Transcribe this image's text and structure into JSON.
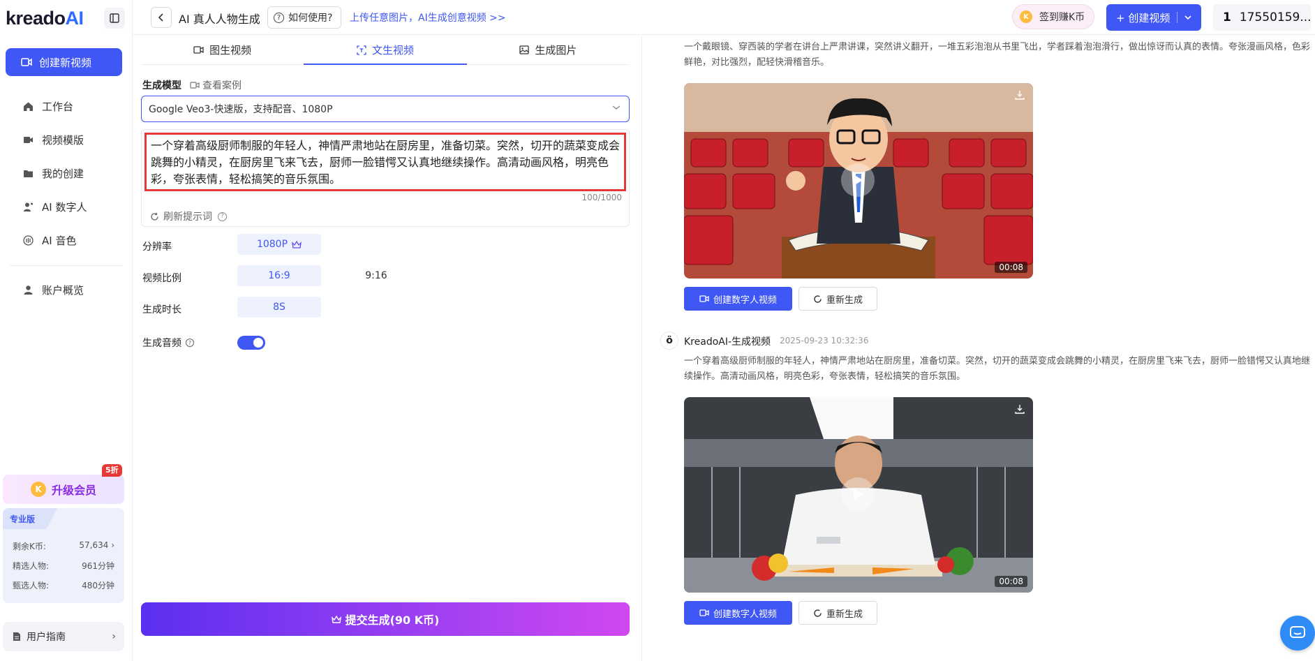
{
  "app": {
    "logo_main": "kreado",
    "logo_ai": "AI"
  },
  "sidebar": {
    "create_new_label": "创建新视频",
    "items": [
      {
        "label": "工作台",
        "icon": "home-icon"
      },
      {
        "label": "视频模版",
        "icon": "video-template-icon"
      },
      {
        "label": "我的创建",
        "icon": "folder-icon"
      },
      {
        "label": "AI 数字人",
        "icon": "digital-human-icon"
      },
      {
        "label": "AI 音色",
        "icon": "voice-icon"
      }
    ],
    "account_label": "账户概览",
    "upgrade_label": "升级会员",
    "discount_badge": "5折",
    "plan": {
      "tag": "专业版",
      "rows": [
        {
          "label": "剩余K币:",
          "value": "57,634 ›"
        },
        {
          "label": "精选人物:",
          "value": "961分钟"
        },
        {
          "label": "甄选人物:",
          "value": "480分钟"
        }
      ]
    },
    "guide_label": "用户指南"
  },
  "topbar": {
    "title": "AI 真人人物生成",
    "howto_label": "如何使用?",
    "promo_link": "上传任意图片，AI生成创意视频 >>",
    "checkin_label": "签到赚K币",
    "create_video_label": "+ 创建视频",
    "user_label": "17550159..."
  },
  "form": {
    "tabs": [
      {
        "label": "图生视频",
        "icon": "image-video-icon"
      },
      {
        "label": "文生视频",
        "icon": "text-video-icon"
      },
      {
        "label": "生成图片",
        "icon": "image-icon"
      }
    ],
    "active_tab": 1,
    "model_label": "生成模型",
    "see_case_label": "查看案例",
    "model_value": "Google Veo3-快速版，支持配音、1080P",
    "prompt": "一个穿着高级厨师制服的年轻人，神情严肃地站在厨房里，准备切菜。突然，切开的蔬菜变成会跳舞的小精灵，在厨房里飞来飞去，厨师一脸错愕又认真地继续操作。高清动画风格，明亮色彩，夸张表情，轻松搞笑的音乐氛围。",
    "counter": "100/1000",
    "refresh_label": "刷新提示词",
    "resolution_label": "分辨率",
    "resolution_value": "1080P",
    "ratio_label": "视频比例",
    "ratio_options": [
      "16:9",
      "9:16"
    ],
    "duration_label": "生成时长",
    "duration_value": "8S",
    "audio_label": "生成音频",
    "audio_on": true,
    "submit_label": "提交生成(90 K币)"
  },
  "results": [
    {
      "description": "一个戴眼镜、穿西装的学者在讲台上严肃讲课，突然讲义翻开，一堆五彩泡泡从书里飞出，学者踩着泡泡滑行，做出惊讶而认真的表情。夸张漫画风格，色彩鲜艳，对比强烈，配轻快滑稽音乐。",
      "duration": "00:08",
      "create_label": "创建数字人视频",
      "regen_label": "重新生成"
    },
    {
      "author": "KreadoAI-生成视频",
      "timestamp": "2025-09-23 10:32:36",
      "description": "一个穿着高级厨师制服的年轻人，神情严肃地站在厨房里，准备切菜。突然，切开的蔬菜变成会跳舞的小精灵，在厨房里飞来飞去，厨师一脸错愕又认真地继续操作。高清动画风格，明亮色彩，夸张表情，轻松搞笑的音乐氛围。",
      "duration": "00:08",
      "create_label": "创建数字人视频",
      "regen_label": "重新生成"
    }
  ],
  "colors": {
    "accent": "#3f57f4",
    "highlight": "#e53935",
    "submit_start": "#5b2ff0",
    "submit_end": "#d048f0"
  }
}
